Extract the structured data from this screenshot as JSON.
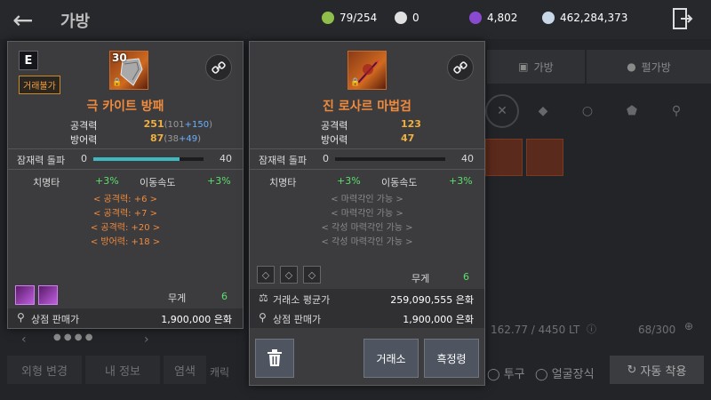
{
  "header": {
    "title": "가방",
    "resources": [
      {
        "icon": "bag-capacity-icon",
        "value": "79/254",
        "color": "#8fbf4a"
      },
      {
        "icon": "pearl-icon",
        "value": "0",
        "color": "#e0e0e0"
      },
      {
        "icon": "purple-gem-icon",
        "value": "4,802",
        "color": "#8a4ad0"
      },
      {
        "icon": "silver-coin-icon",
        "value": "462,284,373",
        "color": "#c8d8e8"
      }
    ]
  },
  "background": {
    "tabs": [
      "가방",
      "펄가방"
    ],
    "weight": "162.77 / 4450 LT",
    "slots": "68/300",
    "bottom_buttons": [
      "외형 변경",
      "내 정보",
      "염색",
      "캐릭",
      "투구",
      "얼굴장식",
      "자동 착용"
    ]
  },
  "card_left": {
    "grade": "E",
    "trade_label": "거래불가",
    "level": "30",
    "name": "극 카이트 방패",
    "stats": [
      {
        "label": "공격력",
        "value": "251",
        "base": "101",
        "bonus": "+150"
      },
      {
        "label": "방어력",
        "value": "87",
        "base": "38",
        "bonus": "+49"
      }
    ],
    "awakening": {
      "label": "잠재력 돌파",
      "min": "0",
      "max": "40",
      "progress": 0.78
    },
    "substats": [
      {
        "label": "치명타",
        "value": "+3%"
      },
      {
        "label": "이동속도",
        "value": "+3%"
      }
    ],
    "options": [
      "< 공격력: +6 >",
      "< 공격력: +7 >",
      "< 공격력: +20 >",
      "< 방어력: +18 >"
    ],
    "weight_label": "무게",
    "weight_value": "6",
    "shop_label": "상점 판매가",
    "shop_value": "1,900,000 은화"
  },
  "card_right": {
    "name": "진 로사르 마법검",
    "stats": [
      {
        "label": "공격력",
        "value": "123"
      },
      {
        "label": "방어력",
        "value": "47"
      }
    ],
    "awakening": {
      "label": "잠재력 돌파",
      "min": "0",
      "max": "40",
      "progress": 0.0
    },
    "substats": [
      {
        "label": "치명타",
        "value": "+3%"
      },
      {
        "label": "이동속도",
        "value": "+3%"
      }
    ],
    "options": [
      "< 마력각인 가능 >",
      "< 마력각인 가능 >",
      "< 각성 마력각인 가능 >",
      "< 각성 마력각인 가능 >"
    ],
    "weight_label": "무게",
    "weight_value": "6",
    "market_label": "거래소 평균가",
    "market_value": "259,090,555 은화",
    "shop_label": "상점 판매가",
    "shop_value": "1,900,000 은화"
  },
  "actions": {
    "trash": "trash-icon",
    "market": "거래소",
    "confirm": "흑정령"
  }
}
